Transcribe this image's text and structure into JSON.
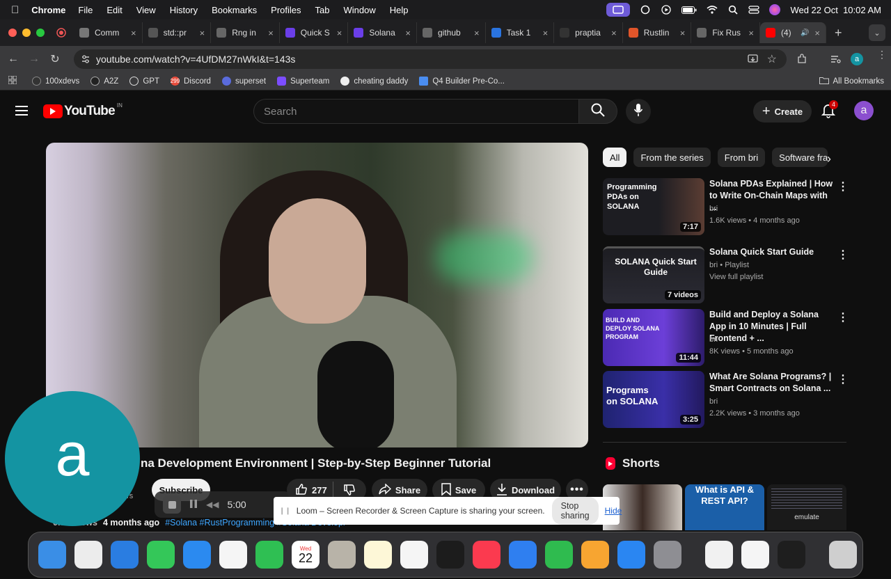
{
  "menubar": {
    "app": "Chrome",
    "items": [
      "File",
      "Edit",
      "View",
      "History",
      "Bookmarks",
      "Profiles",
      "Tab",
      "Window",
      "Help"
    ],
    "datetime": "Wed 22 Oct  10:02 AM"
  },
  "tabs": [
    {
      "label": "Comm",
      "icon": "doc-icon"
    },
    {
      "label": "std::pr",
      "icon": "rust-icon"
    },
    {
      "label": "Rng in",
      "icon": "globe-icon"
    },
    {
      "label": "Quick S",
      "icon": "solana-icon"
    },
    {
      "label": "Solana",
      "icon": "solana-icon"
    },
    {
      "label": "github",
      "icon": "globe-icon"
    },
    {
      "label": "Task 1",
      "icon": "task-icon"
    },
    {
      "label": "praptia",
      "icon": "github-icon"
    },
    {
      "label": "Rustlin",
      "icon": "crab-icon"
    },
    {
      "label": "Fix Rus",
      "icon": "globe-icon"
    },
    {
      "label": "(4)",
      "icon": "youtube-icon"
    }
  ],
  "address": {
    "url": "youtube.com/watch?v=4UfDM27nWkI&t=143s",
    "profile": "a"
  },
  "bookmarks": [
    "100xdevs",
    "A2Z",
    "GPT",
    "Discord",
    "superset",
    "Superteam",
    "cheating daddy",
    "Q4 Builder Pre-Co..."
  ],
  "bookmarks_right": "All Bookmarks",
  "youtube": {
    "logo": "YouTube",
    "region": "IN",
    "search_placeholder": "Search",
    "create_label": "Create",
    "notif_count": "4",
    "avatar": "a"
  },
  "chips": [
    "All",
    "From the series",
    "From bri",
    "Software fra"
  ],
  "recommendations": [
    {
      "title": "Solana PDAs Explained | How to Write On-Chain Maps with ...",
      "channel": "bri",
      "stats": "1.6K views • 4 months ago",
      "duration": "7:17",
      "thumb_text": "Programming PDAs on SOLANA"
    },
    {
      "title": "Solana Quick Start Guide",
      "channel": "bri • Playlist",
      "stats": "View full playlist",
      "duration": "7 videos",
      "thumb_text": "SOLANA Quick Start Guide"
    },
    {
      "title": "Build and Deploy a Solana App in 10 Minutes | Full Frontend + ...",
      "channel": "bri",
      "stats": "8K views • 5 months ago",
      "duration": "11:44",
      "thumb_text": "BUILD AND DEPLOY SOLANA PROGRAM"
    },
    {
      "title": "What Are Solana Programs? | Smart Contracts on Solana ...",
      "channel": "bri",
      "stats": "2.2K views • 3 months ago",
      "duration": "3:25",
      "thumb_text": "Programs on SOLANA"
    }
  ],
  "shorts_label": "Shorts",
  "shorts": [
    {
      "thumb_text": ""
    },
    {
      "thumb_text": "What is API & REST API?"
    },
    {
      "thumb_text": "emulate"
    }
  ],
  "video": {
    "title": "na Development Environment | Step-by-Step Beginner Tutorial",
    "likes": "277",
    "share": "Share",
    "save": "Save",
    "download": "Download",
    "subscribe": "Subscribe",
    "subs": "ers",
    "views": "0.3K views",
    "age": "4 months ago",
    "tags": "#Solana #RustProgramming #Solana Development"
  },
  "loom": {
    "timer": "5:00",
    "message": "Loom – Screen Recorder & Screen Capture is sharing your screen.",
    "stop": "Stop sharing",
    "hide": "Hide"
  },
  "overlay_avatar": "a",
  "dock": [
    {
      "name": "finder-icon",
      "color": "#3a8ee6"
    },
    {
      "name": "launchpad-icon",
      "color": "#ececec"
    },
    {
      "name": "safari-icon",
      "color": "#2a7de1"
    },
    {
      "name": "messages-icon",
      "color": "#34c759"
    },
    {
      "name": "mail-icon",
      "color": "#2b8af0"
    },
    {
      "name": "photos-icon",
      "color": "#f5f5f5"
    },
    {
      "name": "facetime-icon",
      "color": "#2fbf53"
    },
    {
      "name": "calendar-icon",
      "color": "#ffffff"
    },
    {
      "name": "contacts-icon",
      "color": "#b8b3a8"
    },
    {
      "name": "notes-icon",
      "color": "#fdf7d7"
    },
    {
      "name": "freeform-icon",
      "color": "#f5f5f5"
    },
    {
      "name": "tv-icon",
      "color": "#1c1c1c"
    },
    {
      "name": "music-icon",
      "color": "#fb3a4f"
    },
    {
      "name": "keynote-icon",
      "color": "#2f7ff0"
    },
    {
      "name": "numbers-icon",
      "color": "#2fbb4f"
    },
    {
      "name": "pages-icon",
      "color": "#f7a531"
    },
    {
      "name": "appstore-icon",
      "color": "#2a86f2"
    },
    {
      "name": "settings-icon",
      "color": "#8e8e93"
    },
    {
      "name": "chrome-icon",
      "color": "#f1f1f1"
    },
    {
      "name": "vscode-icon",
      "color": "#f5f5f5"
    },
    {
      "name": "terminal-icon",
      "color": "#1e1e1e"
    },
    {
      "name": "trash-icon",
      "color": "#cfcfcf"
    }
  ],
  "calendar_day": "Wed",
  "calendar_date": "22"
}
